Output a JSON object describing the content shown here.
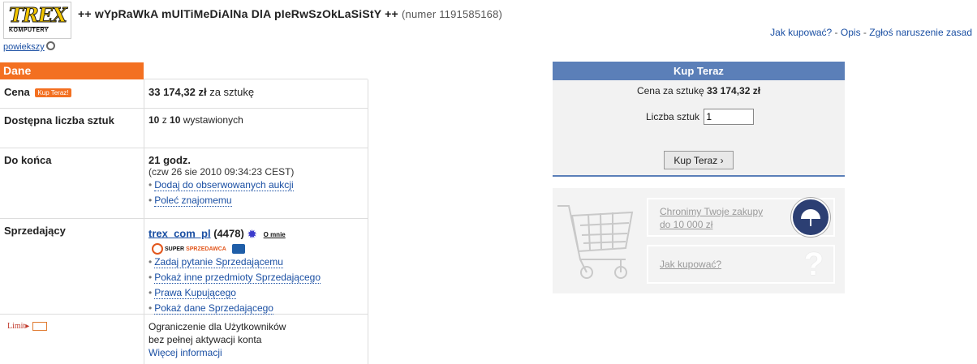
{
  "header": {
    "logo_text": "TREX",
    "logo_subtext": "KOMPUTERY",
    "title": "++ wYpRaWkA mUlTiMeDiAlNa DlA pIeRwSzOkLaSiStY ++",
    "item_number": "(numer 1191585168)",
    "enlarge_link": "powiekszy",
    "links": [
      {
        "label": "Jak kupować?"
      },
      {
        "label": "Opis"
      },
      {
        "label": "Zgłoś naruszenie zasad"
      }
    ],
    "link_separator": " - "
  },
  "details": {
    "section_title": "Dane",
    "price": {
      "label": "Cena",
      "badge": "Kup Teraz!",
      "value": "33 174,32 zł",
      "suffix": "za sztukę"
    },
    "availability": {
      "label": "Dostępna liczba sztuk",
      "available": "10",
      "of_word": "z",
      "total": "10",
      "suffix": "wystawionych"
    },
    "time_left": {
      "label": "Do końca",
      "value": "21 godz.",
      "end_date": "(czw 26 sie 2010 09:34:23 CEST)",
      "links": [
        "Dodaj do obserwowanych aukcji",
        "Poleć znajomemu"
      ]
    },
    "seller": {
      "label": "Sprzedający",
      "name": "trex_com_pl",
      "rating": "(4478)",
      "omnie_badge": "O mnie",
      "super_badge_top": "SUPER",
      "super_badge_bottom": "SPRZEDAWCA",
      "links": [
        "Zadaj pytanie Sprzedającemu",
        "Pokaż inne przedmioty Sprzedającego",
        "Prawa Kupującego",
        "Pokaż dane Sprzedającego"
      ]
    },
    "limit": {
      "label": "Limit",
      "text_line1": "Ograniczenie dla Użytkowników",
      "text_line2": "bez pełnej aktywacji konta",
      "more_link": "Więcej informacji"
    }
  },
  "buy_box": {
    "title": "Kup Teraz",
    "price_label": "Cena za sztukę",
    "price_value": "33 174,32 zł",
    "qty_label": "Liczba sztuk",
    "qty_value": "1",
    "button_label": "Kup Teraz ›"
  },
  "promo": {
    "protect_line1": "Chronimy Twoje zakupy",
    "protect_line2": "do 10 000 zł",
    "howto": "Jak kupować?",
    "question_mark": "?"
  },
  "colors": {
    "accent_orange": "#f37021",
    "buy_header_blue": "#5b7fb8",
    "link_blue": "#1a4fa3"
  }
}
